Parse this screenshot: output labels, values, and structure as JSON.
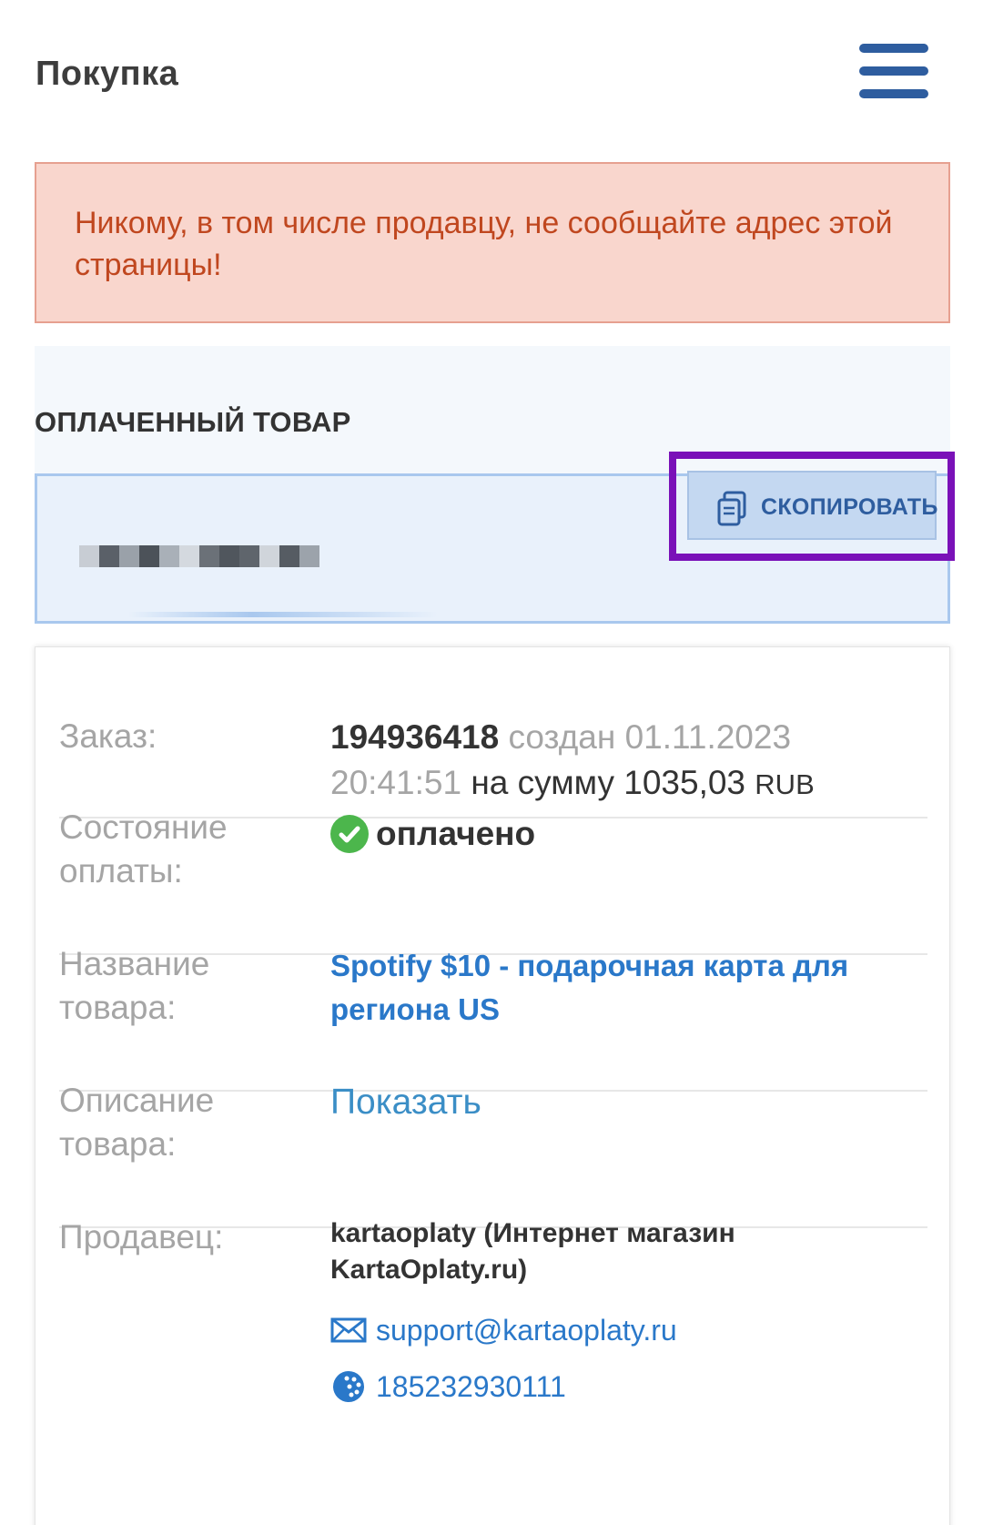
{
  "header": {
    "title": "Покупка",
    "menu_icon": "hamburger-menu-icon"
  },
  "warning": {
    "text": "Никому, в том числе продавцу, не сообщайте адрес этой страницы!"
  },
  "paid_product": {
    "section_title": "ОПЛАЧЕННЫЙ ТОВАР",
    "copy_button_label": "СКОПИРОВАТЬ",
    "copy_icon": "copy-icon",
    "code_state": "pixelated / blurred"
  },
  "order": {
    "label": "Заказ:",
    "number": "194936418",
    "created_text": "создан 01.11.2023",
    "time": "20:41:51",
    "sum_text": "на сумму 1035,03",
    "currency": "RUB"
  },
  "payment_status": {
    "label": "Состояние оплаты:",
    "value": "оплачено",
    "icon": "check-circle-icon",
    "color": "#4cb64c"
  },
  "product_name": {
    "label": "Название товара:",
    "value": "Spotify $10 - подарочная карта для региона US"
  },
  "product_description": {
    "label": "Описание товара:",
    "link": "Показать"
  },
  "seller": {
    "label": "Продавец:",
    "name": "kartaoplaty (Интернет магазин KartaOplaty.ru)",
    "email": "support@kartaoplaty.ru",
    "wmid": "185232930111",
    "email_icon": "envelope-icon",
    "wmid_icon": "webmoney-globe-icon"
  },
  "colors": {
    "accent": "#2e5d9f",
    "link": "#2a78c9",
    "warning_bg": "#f9d6cd",
    "warning_text": "#c0471f",
    "highlight": "#7a11b8"
  }
}
